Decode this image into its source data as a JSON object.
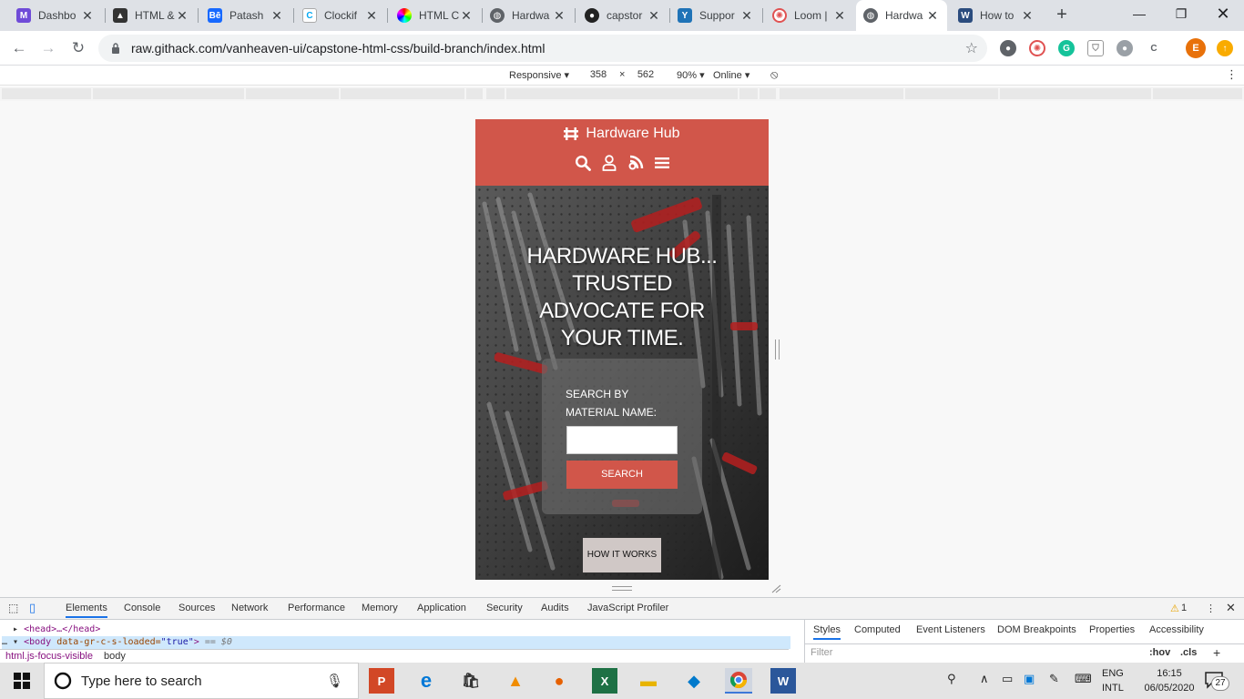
{
  "browser": {
    "tabs": [
      {
        "label": "Dashbo",
        "favicon": "purple-m",
        "active": false
      },
      {
        "label": "HTML &",
        "favicon": "mortarboard",
        "active": false
      },
      {
        "label": "Patash",
        "favicon": "behance",
        "active": false
      },
      {
        "label": "Clockif",
        "favicon": "clockify",
        "active": false
      },
      {
        "label": "HTML C",
        "favicon": "color-wheel",
        "active": false
      },
      {
        "label": "Hardwa",
        "favicon": "globe",
        "active": false
      },
      {
        "label": "capstor",
        "favicon": "github",
        "active": false
      },
      {
        "label": "Suppor",
        "favicon": "zendesk",
        "active": false
      },
      {
        "label": "Loom |",
        "favicon": "loom",
        "active": false
      },
      {
        "label": "Hardwa",
        "favicon": "globe",
        "active": true
      },
      {
        "label": "How to",
        "favicon": "app",
        "active": false
      }
    ],
    "new_tab_label": "+",
    "url": "raw.githack.com/vanheaven-ui/capstone-html-css/build-branch/index.html",
    "profile_initial": "E"
  },
  "device_toolbar": {
    "mode": "Responsive",
    "width": "358",
    "times": "×",
    "height": "562",
    "zoom": "90%",
    "throttle": "Online"
  },
  "site": {
    "brand": "Hardware Hub",
    "hero_title": "HARDWARE HUB... TRUSTED ADVOCATE FOR YOUR TIME.",
    "search_label": "SEARCH BY MATERIAL NAME:",
    "search_value": "",
    "search_button": "SEARCH",
    "how_button": "HOW IT WORKS",
    "brand_color": "#d1564a"
  },
  "devtools": {
    "tabs": [
      "Elements",
      "Console",
      "Sources",
      "Network",
      "Performance",
      "Memory",
      "Application",
      "Security",
      "Audits",
      "JavaScript Profiler"
    ],
    "active_tab": "Elements",
    "warning_count": "1",
    "dom": {
      "head_line": "<head>…</head>",
      "body_open": "<body",
      "body_attr_name": "data-gr-c-s-loaded=",
      "body_attr_value": "\"true\"",
      "body_close": ">",
      "selected_marker": "== $0"
    },
    "breadcrumb": [
      "html.js-focus-visible",
      "body"
    ],
    "styles_tabs": [
      "Styles",
      "Computed",
      "Event Listeners",
      "DOM Breakpoints",
      "Properties",
      "Accessibility"
    ],
    "filter_placeholder": "Filter",
    "hov": ":hov",
    "cls": ".cls"
  },
  "taskbar": {
    "search_placeholder": "Type here to search",
    "lang_line1": "ENG",
    "lang_line2": "INTL",
    "time": "16:15",
    "date": "06/05/2020",
    "notification_count": "27"
  }
}
